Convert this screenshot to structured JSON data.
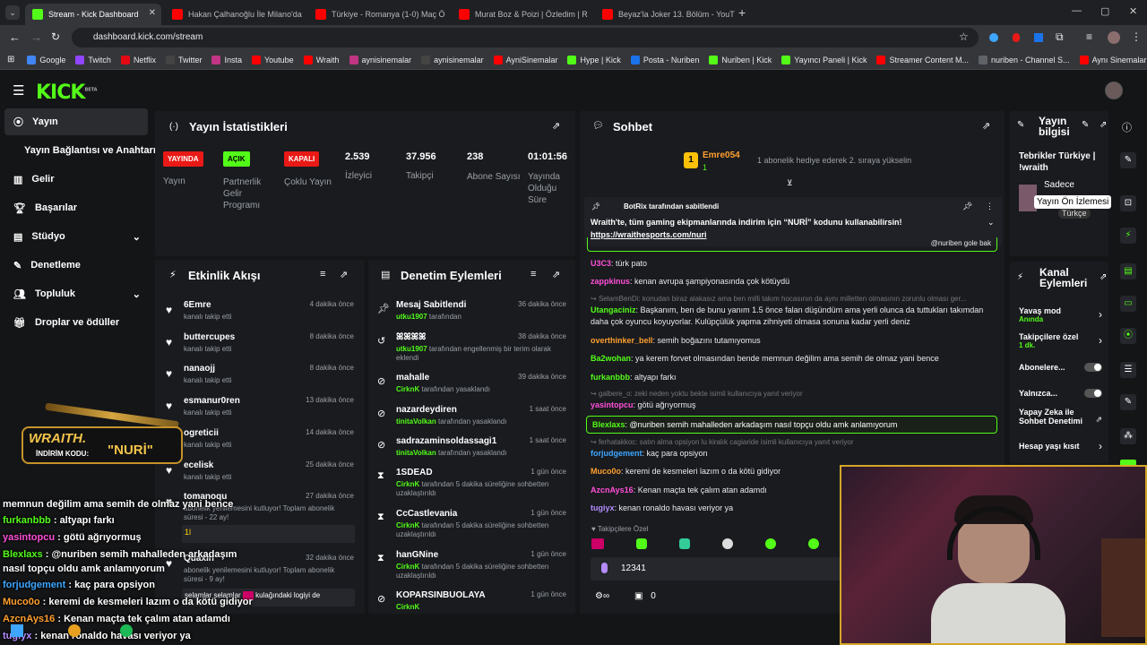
{
  "browser": {
    "tabs": [
      {
        "title": "Stream - Kick Dashboard",
        "active": true,
        "color": "#53fc18"
      },
      {
        "title": "Hakan Çalhanoğlu İle Milano'da",
        "active": false,
        "color": "#ff0000"
      },
      {
        "title": "Türkiye - Romanya (1-0) Maç Ö",
        "active": false,
        "color": "#ff0000"
      },
      {
        "title": "Murat Boz & Poizi | Özledim | R",
        "active": false,
        "color": "#ff0000"
      },
      {
        "title": "Beyaz'la Joker 13. Bölüm - YouT",
        "active": false,
        "color": "#ff0000"
      }
    ],
    "url": "dashboard.kick.com/stream",
    "bookmarks": [
      "Google",
      "Twitch",
      "Netflix",
      "Twitter",
      "Insta",
      "Youtube",
      "Wraith",
      "aynisinemalar",
      "aynisinemalar",
      "AyniSinemalar",
      "Hype | Kick",
      "Posta - Nuriben",
      "Nuriben | Kick",
      "Yayıncı Paneli | Kick",
      "Streamer Content M...",
      "nuriben - Channel S...",
      "Aynı Sinemalar - Ça..."
    ]
  },
  "kick": {
    "logo": "KICK",
    "logo_beta": "BETA"
  },
  "sidebar": {
    "items": [
      {
        "label": "Yayın"
      },
      {
        "label": "Yayın Bağlantısı ve Anahtarı"
      },
      {
        "label": "Gelir"
      },
      {
        "label": "Başarılar"
      },
      {
        "label": "Stüdyo"
      },
      {
        "label": "Denetleme"
      },
      {
        "label": "Topluluk"
      },
      {
        "label": "Droplar ve ödüller"
      }
    ]
  },
  "stats": {
    "title": "Yayın İstatistikleri",
    "badges": [
      {
        "badge": "YAYINDA",
        "label": "Yayın",
        "color": "#e91916"
      },
      {
        "badge": "AÇIK",
        "label": "Partnerlik Gelir Programı",
        "color": "#53fc18"
      },
      {
        "badge": "KAPALI",
        "label": "Çoklu Yayın",
        "color": "#e91916"
      }
    ],
    "numbers": [
      {
        "value": "2.539",
        "label": "İzleyici"
      },
      {
        "value": "37.956",
        "label": "Takipçi"
      },
      {
        "value": "238",
        "label": "Abone Sayısı"
      },
      {
        "value": "01:01:56",
        "label": "Yayında Olduğu Süre"
      }
    ]
  },
  "activity": {
    "title": "Etkinlik Akışı",
    "items": [
      {
        "name": "6Emre",
        "sub": "kanalı takip etti",
        "time": "4 dakika önce"
      },
      {
        "name": "buttercupes",
        "sub": "kanalı takip etti",
        "time": "8 dakika önce"
      },
      {
        "name": "nanaojj",
        "sub": "kanalı takip etti",
        "time": "8 dakika önce"
      },
      {
        "name": "esmanur0ren",
        "sub": "kanalı takip etti",
        "time": "13 dakika önce"
      },
      {
        "name": "ogreticii",
        "sub": "kanalı takip etti",
        "time": "14 dakika önce"
      },
      {
        "name": "ecelisk",
        "sub": "kanalı takip etti",
        "time": "25 dakika önce"
      },
      {
        "name": "tomanoqu",
        "sub": "abonelik yenilemesini kutluyor! Toplam abonelik süresi - 22 ay!",
        "time": "27 dakika önce"
      },
      {
        "name": "Quaxin",
        "sub": "abonelik yenilemesini kutluyor! Toplam abonelik süresi - 9 ay!",
        "time": "32 dakika önce"
      }
    ],
    "msg1": "1l",
    "msg2": "selamlar selamlar",
    "msg2b": "kulağındaki logiyi de"
  },
  "moderation": {
    "title": "Denetim Eylemleri",
    "items": [
      {
        "name": "Mesaj Sabitlendi",
        "by": "utku1907",
        "sub": "tarafından",
        "time": "36 dakika önce"
      },
      {
        "name": "ꕤꕤꕤꕤ",
        "by": "utku1907",
        "sub": "tarafından engellenmiş bir terim olarak eklendi",
        "time": "38 dakika önce"
      },
      {
        "name": "mahalle",
        "by": "CirknK",
        "sub": "tarafından yasaklandı",
        "time": "39 dakika önce"
      },
      {
        "name": "nazardeydiren",
        "by": "tinitaVolkan",
        "sub": "tarafından yasaklandı",
        "time": "1 saat önce"
      },
      {
        "name": "sadrazaminsoldassagi1",
        "by": "tinitaVolkan",
        "sub": "tarafından yasaklandı",
        "time": "1 saat önce"
      },
      {
        "name": "1SDEAD",
        "by": "CirknK",
        "sub": "tarafından 5 dakika süreliğine sohbetten uzaklaştırıldı",
        "time": "1 gün önce"
      },
      {
        "name": "CcCastlevania",
        "by": "CirknK",
        "sub": "tarafından 5 dakika süreliğine sohbetten uzaklaştırıldı",
        "time": "1 gün önce"
      },
      {
        "name": "hanGNine",
        "by": "CirknK",
        "sub": "tarafından 5 dakika süreliğine sohbetten uzaklaştırıldı",
        "time": "1 gün önce"
      },
      {
        "name": "KOPARSINBUOLAYA",
        "by": "CirknK",
        "sub": "",
        "time": "1 gün önce"
      }
    ]
  },
  "chat": {
    "title": "Sohbet",
    "gift_user": "Emre054",
    "gift_count": "1",
    "gift_text": "1 abonelik hediye ederek 2. sıraya yükselin",
    "pinned_header": "BotRix tarafından sabitlendi",
    "pinned_text": "Wraith'te, tüm gaming ekipmanlarında indirim için “NURİ” kodunu kullanabilirsin!",
    "pinned_link": "https://wraithesports.com/nuri",
    "messages": [
      {
        "user": "U3C3",
        "color": "#ff4fd8",
        "text": "türk pato"
      },
      {
        "user": "zappkinus",
        "color": "#ff4fd8",
        "text": "kenan avrupa şampiyonasında çok kötüydü"
      },
      {
        "user": "Utangaciniz",
        "color": "#53fc18",
        "text": "Başkanım, ben de bunu yanım 1.5 önce falan düşündüm ama yerli olunca da tuttukları takımdan"
      },
      {
        "user": "",
        "color": "#e8eaed",
        "text": "daha çok oyuncu koyuyorlar. Kulüpçülük yapma zihniyeti olmasa sonuna kadar yerli deniz"
      },
      {
        "user": "overthinker_bell",
        "color": "#ff9f2e",
        "text": "semih boğazını tutamıyomus"
      },
      {
        "user": "Ba2wohan",
        "color": "#53fc18",
        "text": "ya kerem forvet olmasından bende memnun değilim ama semih de olmaz yani bence"
      },
      {
        "user": "furkanbbb",
        "color": "#53fc18",
        "text": "altyapı farkı"
      },
      {
        "user": "yasintopcu",
        "color": "#ff4fd8",
        "text": "götü ağrıyormuş"
      },
      {
        "user": "forjudgement",
        "color": "#3ea6ff",
        "text": "kaç para opsiyon"
      },
      {
        "user": "Muco0o",
        "color": "#ff9f2e",
        "text": "keremi de kesmeleri lazım o da kötü gidiyor"
      },
      {
        "user": "AzcnAys16",
        "color": "#ff4fd8",
        "text": "Kenan maçta tek çalım atan adamdı"
      },
      {
        "user": "tugiyx",
        "color": "#b48cff",
        "text": "kenan ronaldo havası veriyor ya"
      }
    ],
    "replies": [
      "SelamBenDi: konudan biraz alakasız ama ben milli takım hocasının da aynı milletten olmasının zorunlu olması ger...",
      "galbere_o: zeki neden yoktu bekte isimli kullanıcıya yanıt veriyor",
      "ferhatakkoc: satın alma opsiyon lu kiralık cagiaride isimli kullanıcıya yanıt veriyor"
    ],
    "hl_top": "@nuriben gole bak",
    "highlight": {
      "user": "Blexlaxs",
      "text": "@nuriben semih mahalleden arkadaşım nasıl topçu oldu amk anlamıyorum"
    },
    "followers_only": "Takipçilere Özel",
    "input_value": "12341",
    "footer_count": "0"
  },
  "stream_info": {
    "title": "Yayın bilgisi",
    "text": "Tebrikler Türkiye | !wraith",
    "sub": "Sadece",
    "tag": "Türkçe",
    "tooltip": "Yayın Ön İzlemesi"
  },
  "channel_actions": {
    "title": "Kanal Eylemleri",
    "items": [
      {
        "label": "Yavaş mod",
        "sub": "Anında"
      },
      {
        "label": "Takipçilere özel",
        "sub": "1 dk."
      },
      {
        "label": "Abonelere...",
        "sub": ""
      },
      {
        "label": "Yalnızca...",
        "sub": ""
      },
      {
        "label": "Yapay Zeka ile Sohbet Denetimi",
        "sub": ""
      },
      {
        "label": "Hesap yaşı kısıt",
        "sub": ""
      }
    ]
  },
  "overlay": {
    "sponsor": "WRAITH.",
    "promo_label": "İNDİRİM KODU:",
    "promo_code": "\"NURİ\"",
    "lines": [
      {
        "user": "",
        "color": "#ffffff",
        "text": "memnun değilim ama semih de olmaz yani bence"
      },
      {
        "user": "furkanbbb",
        "color": "#53fc18",
        "text": ": altyapı farkı"
      },
      {
        "user": "yasintopcu",
        "color": "#ff4fd8",
        "text": ": götü ağrıyormuş"
      },
      {
        "user": "Blexlaxs",
        "color": "#53fc18",
        "text": ": @nuriben semih mahalleden arkadaşım"
      },
      {
        "user": "",
        "color": "#ffffff",
        "text": "nasıl topçu oldu amk anlamıyorum"
      },
      {
        "user": "forjudgement",
        "color": "#3ea6ff",
        "text": ": kaç para opsiyon"
      },
      {
        "user": "Muco0o",
        "color": "#ff9f2e",
        "text": ": keremi de kesmeleri lazım o da kötü gidiyor"
      },
      {
        "user": "AzcnAys16",
        "color": "#ff9f2e",
        "text": ": Kenan maçta tek çalım atan adamdı"
      },
      {
        "user": "tugiyx",
        "color": "#b48cff",
        "text": ": kenan ronaldo havası veriyor ya"
      }
    ]
  }
}
